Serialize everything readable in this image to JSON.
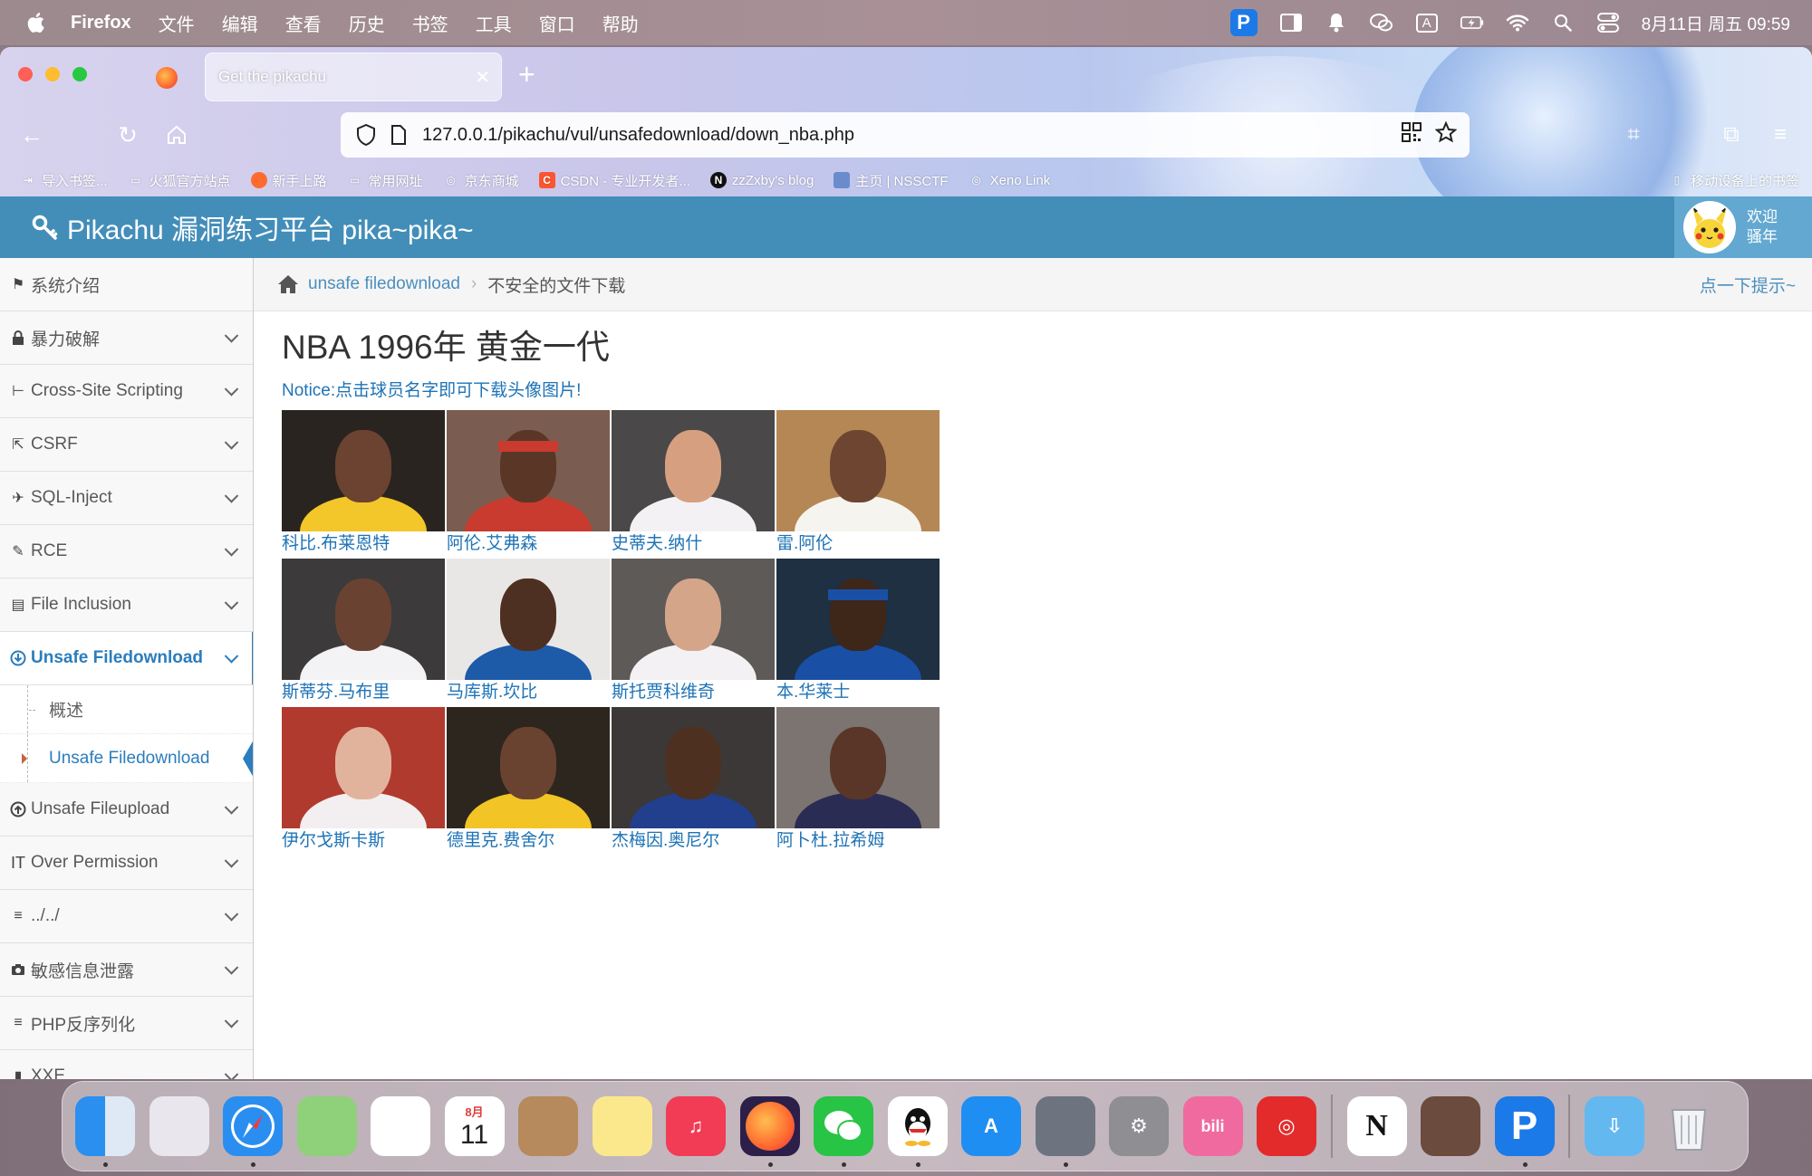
{
  "menubar": {
    "app_name": "Firefox",
    "menus": [
      "文件",
      "编辑",
      "查看",
      "历史",
      "书签",
      "工具",
      "窗口",
      "帮助"
    ],
    "status_icons": [
      "p-app-icon",
      "sidebar-icon",
      "bell-icon",
      "wechat-icon",
      "input-method-icon",
      "battery-icon",
      "wifi-icon",
      "spotlight-icon",
      "control-center-icon"
    ],
    "input_method": "A",
    "clock": "8月11日 周五 09:59"
  },
  "browser": {
    "tab_title": "Get the pikachu",
    "url": "127.0.0.1/pikachu/vul/unsafedownload/down_nba.php",
    "bookmarks": [
      {
        "label": "导入书签...",
        "icon": "import-icon",
        "color": "transparent"
      },
      {
        "label": "火狐官方站点",
        "icon": "folder-icon",
        "color": "transparent"
      },
      {
        "label": "新手上路",
        "icon": "firefox-icon",
        "color": "#ff6a2f"
      },
      {
        "label": "常用网址",
        "icon": "folder-icon",
        "color": "transparent"
      },
      {
        "label": "京东商城",
        "icon": "globe-icon",
        "color": "transparent"
      },
      {
        "label": "CSDN - 专业开发者...",
        "icon": "csdn-icon",
        "color": "#fc5531"
      },
      {
        "label": "zzZxby's blog",
        "icon": "n-icon",
        "color": "#111111"
      },
      {
        "label": "主页 | NSSCTF",
        "icon": "nss-icon",
        "color": "#6a8ccc"
      },
      {
        "label": "Xeno Link",
        "icon": "globe-icon",
        "color": "transparent"
      }
    ],
    "mobile_bookmarks": "移动设备上的书签"
  },
  "app": {
    "brand": "Pikachu 漏洞练习平台 pika~pika~",
    "welcome_line1": "欢迎",
    "welcome_line2": "骚年",
    "colors": {
      "header": "#438eb9",
      "link": "#1e73b6",
      "active": "#2b7dbc"
    }
  },
  "sidebar": {
    "items": [
      {
        "label": "系统介绍",
        "icon": "tags-icon",
        "glyph": "⚑",
        "has_chevron": false
      },
      {
        "label": "暴力破解",
        "icon": "lock-icon",
        "glyph": "🔒",
        "has_chevron": true
      },
      {
        "label": "Cross-Site Scripting",
        "icon": "tree-icon",
        "glyph": "⊢",
        "has_chevron": true
      },
      {
        "label": "CSRF",
        "icon": "external-link-icon",
        "glyph": "⇱",
        "has_chevron": true
      },
      {
        "label": "SQL-Inject",
        "icon": "plane-icon",
        "glyph": "✈",
        "has_chevron": true
      },
      {
        "label": "RCE",
        "icon": "pencil-icon",
        "glyph": "✎",
        "has_chevron": true
      },
      {
        "label": "File Inclusion",
        "icon": "file-icon",
        "glyph": "▤",
        "has_chevron": true
      },
      {
        "label": "Unsafe Filedownload",
        "icon": "download-circle-icon",
        "glyph": "⊕",
        "has_chevron": true,
        "active": true
      }
    ],
    "sub_items": [
      {
        "label": "概述",
        "active": false
      },
      {
        "label": "Unsafe Filedownload",
        "active": true
      }
    ],
    "items_after": [
      {
        "label": "Unsafe Fileupload",
        "icon": "upload-circle-icon",
        "glyph": "⊕"
      },
      {
        "label": "Over Permission",
        "icon": "text-height-icon",
        "glyph": "IT"
      },
      {
        "label": "../../",
        "icon": "align-left-icon",
        "glyph": "≡"
      },
      {
        "label": "敏感信息泄露",
        "icon": "camera-icon",
        "glyph": "◙"
      },
      {
        "label": "PHP反序列化",
        "icon": "list-icon",
        "glyph": "≡"
      },
      {
        "label": "XXE",
        "icon": "code-icon",
        "glyph": "▮"
      }
    ]
  },
  "breadcrumb": {
    "link": "unsafe filedownload",
    "current": "不安全的文件下载",
    "tip": "点一下提示~"
  },
  "content": {
    "title": "NBA 1996年 黄金一代",
    "notice": "Notice:点击球员名字即可下载头像图片!",
    "players": [
      {
        "name": "科比.布莱恩特",
        "bg": "#2a2420",
        "skin": "#6b4330",
        "jersey": "#f3c629"
      },
      {
        "name": "阿伦.艾弗森",
        "bg": "#7a5c50",
        "skin": "#5a3626",
        "jersey": "#c83b2e"
      },
      {
        "name": "史蒂夫.纳什",
        "bg": "#4a4848",
        "skin": "#d6a080",
        "jersey": "#f4f1f4"
      },
      {
        "name": "雷.阿伦",
        "bg": "#b58755",
        "skin": "#6e4530",
        "jersey": "#f6f4ef"
      },
      {
        "name": "斯蒂芬.马布里",
        "bg": "#3c3a3a",
        "skin": "#6a4232",
        "jersey": "#f3f2f4"
      },
      {
        "name": "马库斯.坎比",
        "bg": "#e9e7e6",
        "skin": "#4e3022",
        "jersey": "#1d5aa8"
      },
      {
        "name": "斯托贾科维奇",
        "bg": "#5e5a58",
        "skin": "#d5a589",
        "jersey": "#f3f1f4"
      },
      {
        "name": "本.华莱士",
        "bg": "#1e3042",
        "skin": "#3e2619",
        "jersey": "#1a4fa6"
      },
      {
        "name": "伊尔戈斯卡斯",
        "bg": "#b03a2e",
        "skin": "#e2b39c",
        "jersey": "#f3eff0"
      },
      {
        "name": "德里克.费舍尔",
        "bg": "#2c261e",
        "skin": "#6a4330",
        "jersey": "#f3c425"
      },
      {
        "name": "杰梅因.奥尼尔",
        "bg": "#3c3838",
        "skin": "#4e3020",
        "jersey": "#223f8e"
      },
      {
        "name": "阿卜杜.拉希姆",
        "bg": "#7b7470",
        "skin": "#5a3628",
        "jersey": "#2a2c54"
      }
    ]
  },
  "dock": {
    "apps": [
      {
        "name": "finder-icon",
        "bg": "linear-gradient(90deg,#2b8ff0 50%,#dfe9f6 50%)",
        "label": ""
      },
      {
        "name": "launchpad-icon",
        "bg": "#e9e6ee",
        "label": ""
      },
      {
        "name": "safari-icon",
        "bg": "#2a8ef0",
        "label": ""
      },
      {
        "name": "maps-icon",
        "bg": "#8fd07a",
        "label": ""
      },
      {
        "name": "photos-icon",
        "bg": "#ffffff",
        "label": ""
      },
      {
        "name": "calendar-icon",
        "bg": "#ffffff",
        "label": "11"
      },
      {
        "name": "contacts-icon",
        "bg": "#b68a5c",
        "label": ""
      },
      {
        "name": "notes-icon",
        "bg": "#fbe88c",
        "label": ""
      },
      {
        "name": "music-icon",
        "bg": "#f23b55",
        "label": "♫"
      },
      {
        "name": "firefox-icon",
        "bg": "#2c1f4a",
        "label": ""
      },
      {
        "name": "wechat-icon",
        "bg": "#28c445",
        "label": ""
      },
      {
        "name": "qq-icon",
        "bg": "#ffffff",
        "label": ""
      },
      {
        "name": "appstore-icon",
        "bg": "#1e8ef2",
        "label": "A"
      },
      {
        "name": "parallels-icon",
        "bg": "#6d7480",
        "label": ""
      },
      {
        "name": "system-settings-icon",
        "bg": "#8e8e93",
        "label": "⚙"
      },
      {
        "name": "bilibili-icon",
        "bg": "#f06aa0",
        "label": "bili"
      },
      {
        "name": "netease-music-icon",
        "bg": "#e32b2b",
        "label": "◎"
      },
      {
        "name": "notion-icon",
        "bg": "#ffffff",
        "label": "N"
      },
      {
        "name": "anime-app-icon",
        "bg": "#6b4b3e",
        "label": ""
      },
      {
        "name": "p-app-icon",
        "bg": "#1b7ae8",
        "label": "P"
      },
      {
        "name": "downloads-folder-icon",
        "bg": "#64b8f0",
        "label": "⇩"
      },
      {
        "name": "trash-icon",
        "bg": "#e4e6ea",
        "label": ""
      }
    ],
    "calendar_month": "8月"
  }
}
